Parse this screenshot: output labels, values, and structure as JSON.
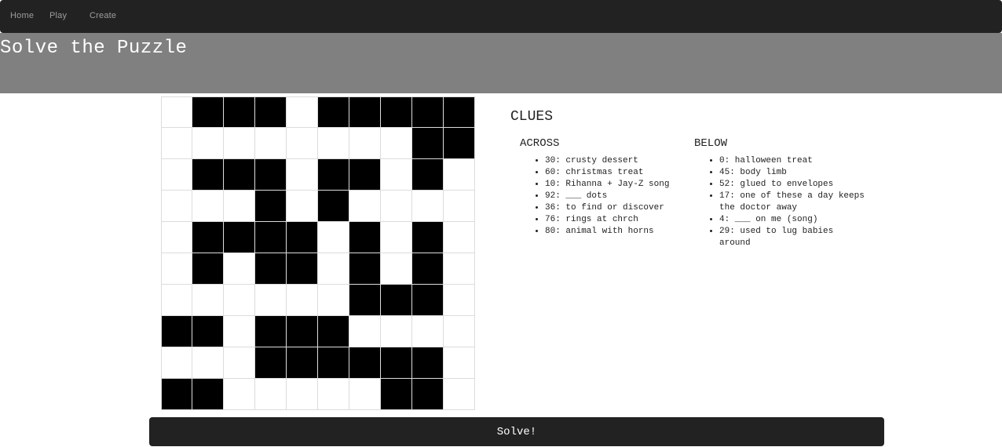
{
  "nav": {
    "items": [
      {
        "label": "Home"
      },
      {
        "label": "Play"
      },
      {
        "label": "Create"
      }
    ]
  },
  "header": {
    "title": "Solve the Puzzle"
  },
  "puzzle": {
    "grid": [
      [
        0,
        1,
        1,
        1,
        0,
        1,
        1,
        1,
        1,
        1
      ],
      [
        0,
        0,
        0,
        0,
        0,
        0,
        0,
        0,
        1,
        1
      ],
      [
        0,
        1,
        1,
        1,
        0,
        1,
        1,
        0,
        1,
        0
      ],
      [
        0,
        0,
        0,
        1,
        0,
        1,
        0,
        0,
        0,
        0
      ],
      [
        0,
        1,
        1,
        1,
        1,
        0,
        1,
        0,
        1,
        0
      ],
      [
        0,
        1,
        0,
        1,
        1,
        0,
        1,
        0,
        1,
        0
      ],
      [
        0,
        0,
        0,
        0,
        0,
        0,
        1,
        1,
        1,
        0
      ],
      [
        1,
        1,
        0,
        1,
        1,
        1,
        0,
        0,
        0,
        0
      ],
      [
        0,
        0,
        0,
        1,
        1,
        1,
        1,
        1,
        1,
        0
      ],
      [
        1,
        1,
        0,
        0,
        0,
        0,
        0,
        1,
        1,
        0
      ]
    ]
  },
  "clues": {
    "title": "CLUES",
    "across": {
      "title": "ACROSS",
      "items": [
        "30: crusty dessert",
        "60: christmas treat",
        "10: Rihanna + Jay-Z song",
        "92: ___ dots",
        "36: to find or discover",
        "76: rings at chrch",
        "80: animal with horns"
      ]
    },
    "below": {
      "title": "BELOW",
      "items": [
        "0: halloween treat",
        "45: body limb",
        "52: glued to envelopes",
        "17: one of these a day keeps the doctor away",
        "4: ___ on me (song)",
        "29: used to lug babies around"
      ]
    }
  },
  "actions": {
    "solve_label": "Solve!"
  }
}
